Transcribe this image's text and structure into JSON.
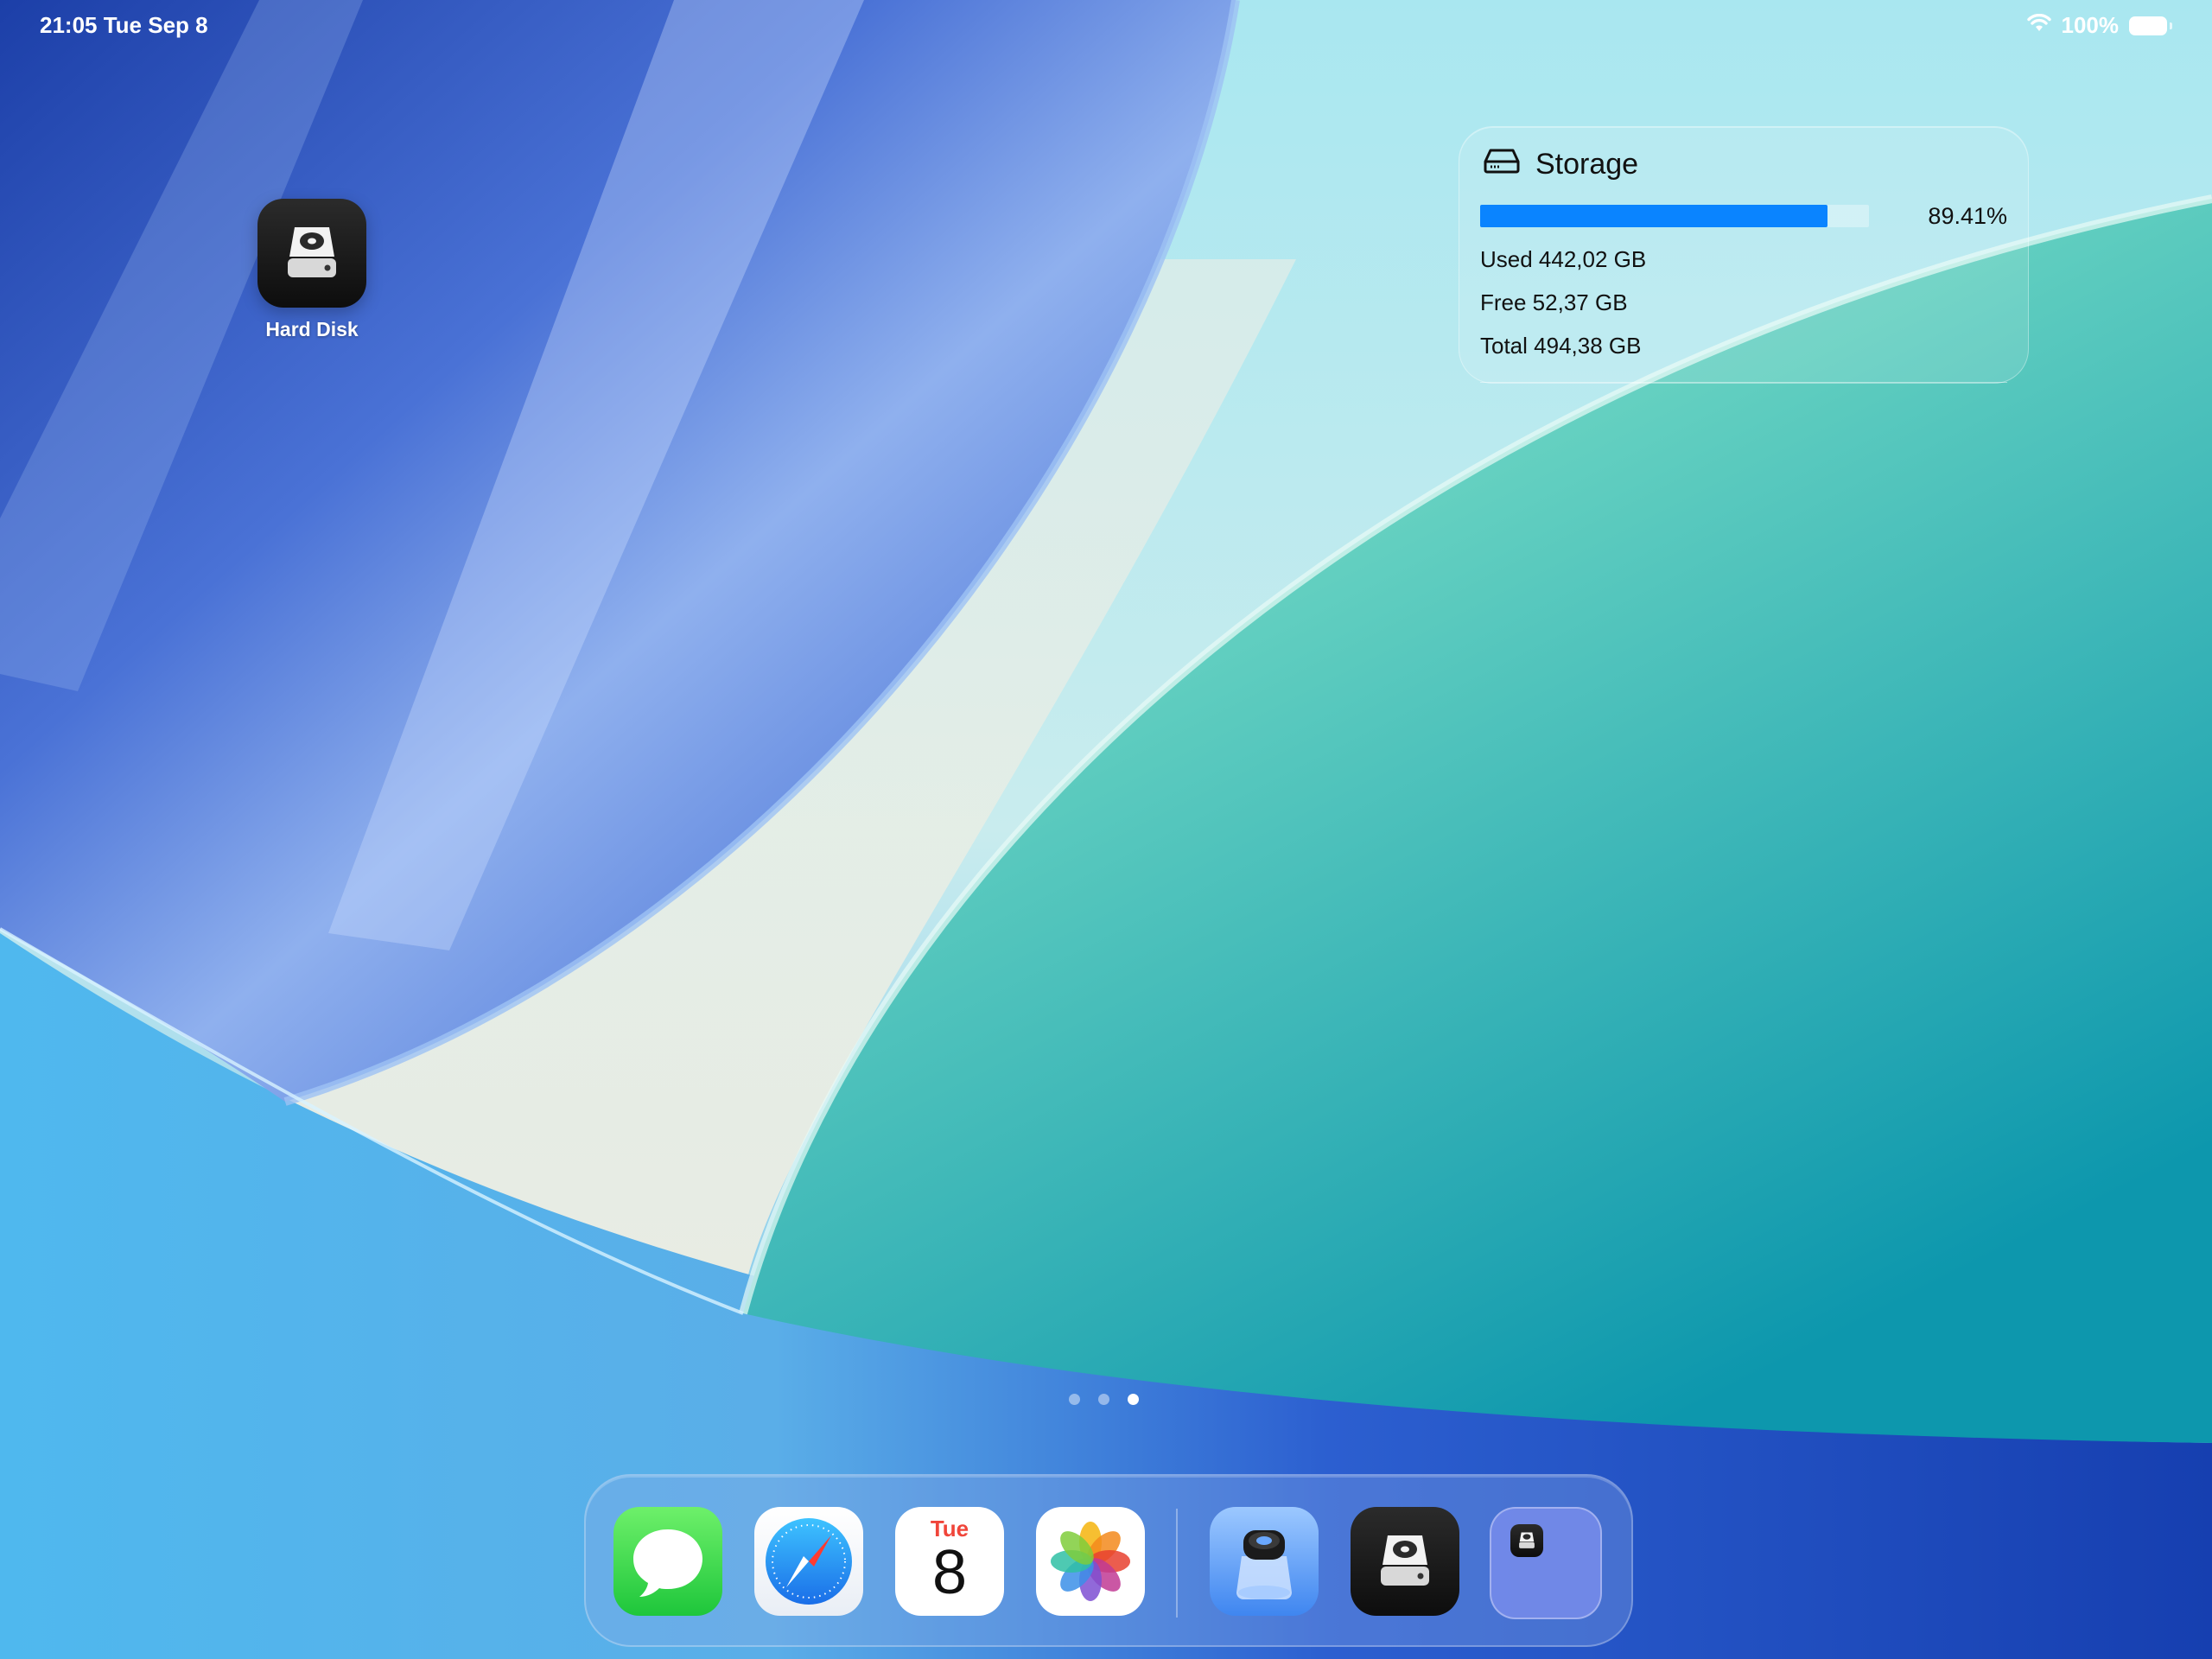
{
  "status_bar": {
    "time_date": "21:05  Tue Sep 8",
    "battery_percent": "100%",
    "wifi_icon": "wifi-icon",
    "battery_icon": "battery-icon"
  },
  "desktop": {
    "apps": [
      {
        "label": "Hard Disk",
        "icon": "hard-disk-icon"
      }
    ]
  },
  "storage_widget": {
    "title": "Storage",
    "icon": "drive-icon",
    "usage_percent": "89.41%",
    "usage_fraction": 0.8941,
    "bar_color": "#0a84ff",
    "used": "Used 442,02 GB",
    "free": "Free 52,37 GB",
    "total": "Total 494,38 GB"
  },
  "page_dots": {
    "count": 3,
    "active_index": 2
  },
  "dock": {
    "apps": [
      {
        "name": "Messages",
        "icon": "messages-icon"
      },
      {
        "name": "Safari",
        "icon": "safari-icon"
      },
      {
        "name": "Calendar",
        "icon": "calendar-icon",
        "day": "Tue",
        "date": "8"
      },
      {
        "name": "Photos",
        "icon": "photos-icon"
      },
      {
        "name": "Preview",
        "icon": "preview-icon"
      },
      {
        "name": "Hard Disk",
        "icon": "hard-disk-icon"
      },
      {
        "name": "App Library folder",
        "icon": "folder-icon"
      }
    ]
  }
}
